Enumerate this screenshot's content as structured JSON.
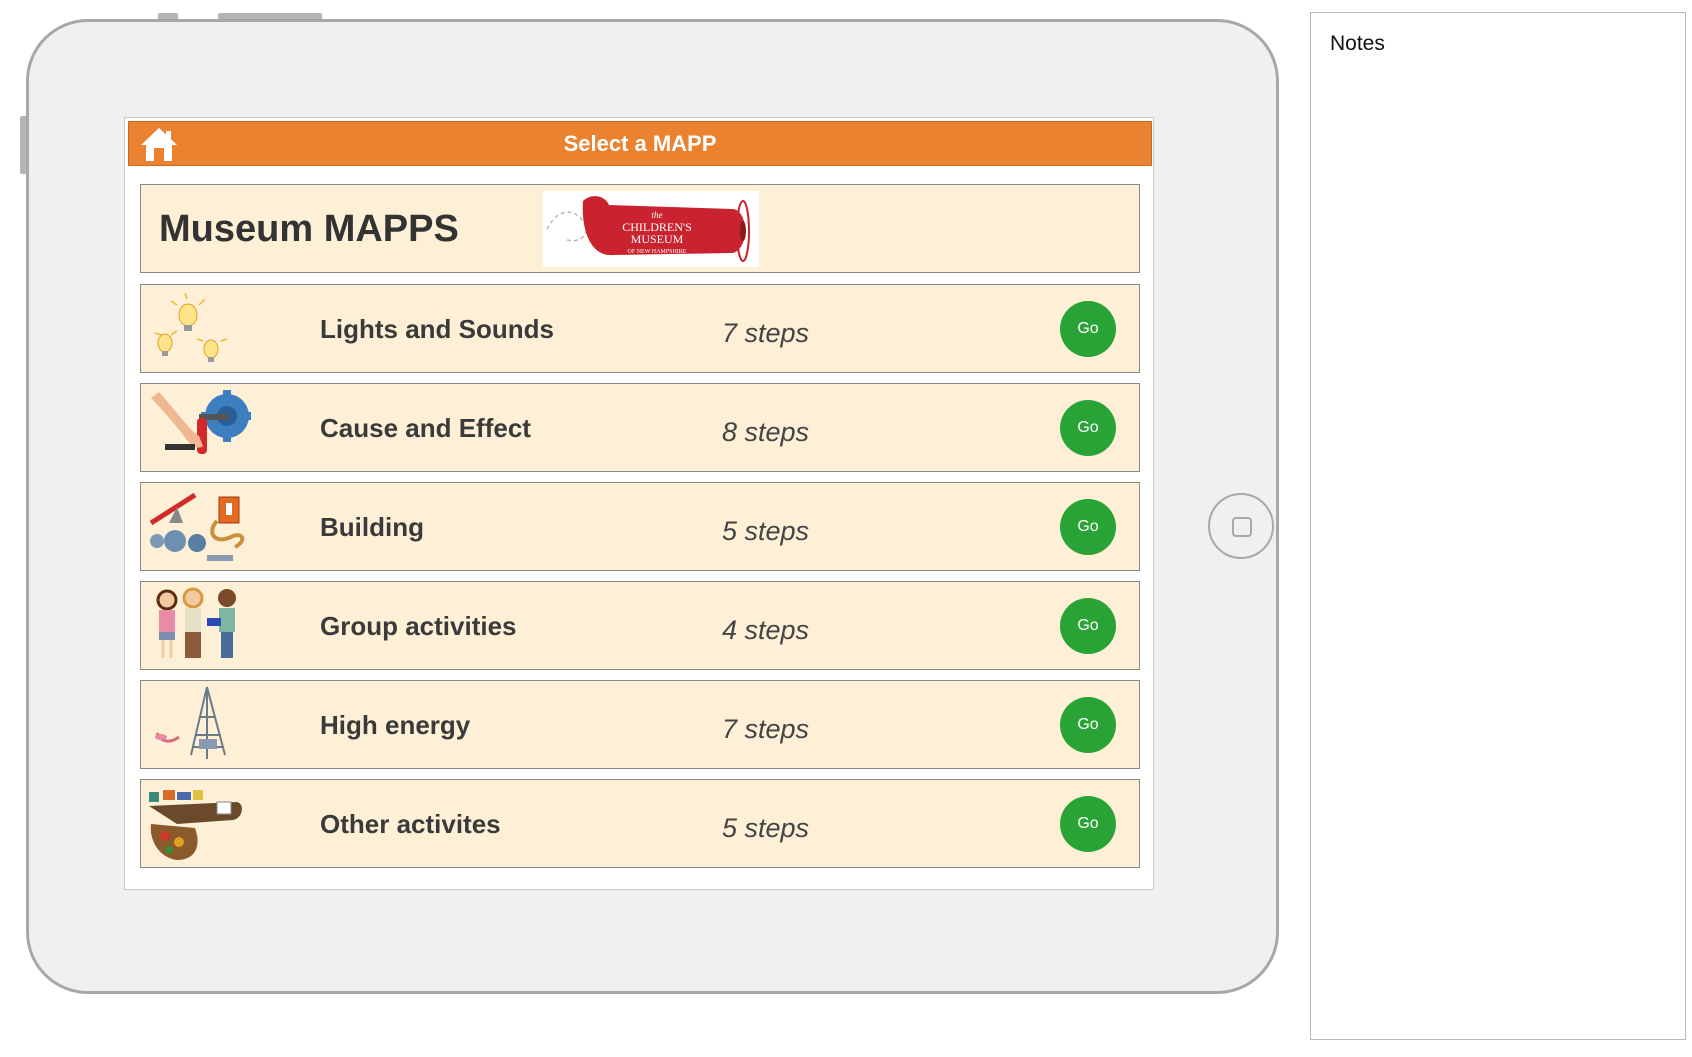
{
  "app": {
    "title": "Select a MAPP",
    "header_title": "Museum MAPPS",
    "logo_text": [
      "the",
      "CHILDREN'S",
      "MUSEUM",
      "OF NEW HAMPSHIRE"
    ]
  },
  "colors": {
    "title_bar": "#ea8230",
    "card_bg": "#fdf0d7",
    "go_button": "#2aa336"
  },
  "activities": [
    {
      "name": "Lights and Sounds",
      "steps": "7 steps",
      "go_label": "Go",
      "icon": "light-bulbs-icon"
    },
    {
      "name": "Cause and Effect",
      "steps": "8 steps",
      "go_label": "Go",
      "icon": "hand-crank-gear-icon"
    },
    {
      "name": "Building",
      "steps": "5 steps",
      "go_label": "Go",
      "icon": "building-tools-icon"
    },
    {
      "name": "Group activities",
      "steps": "4 steps",
      "go_label": "Go",
      "icon": "children-group-icon"
    },
    {
      "name": "High energy",
      "steps": "7 steps",
      "go_label": "Go",
      "icon": "tower-structure-icon"
    },
    {
      "name": "Other activites",
      "steps": "5 steps",
      "go_label": "Go",
      "icon": "craft-table-icon"
    }
  ],
  "notes": {
    "title": "Notes"
  }
}
